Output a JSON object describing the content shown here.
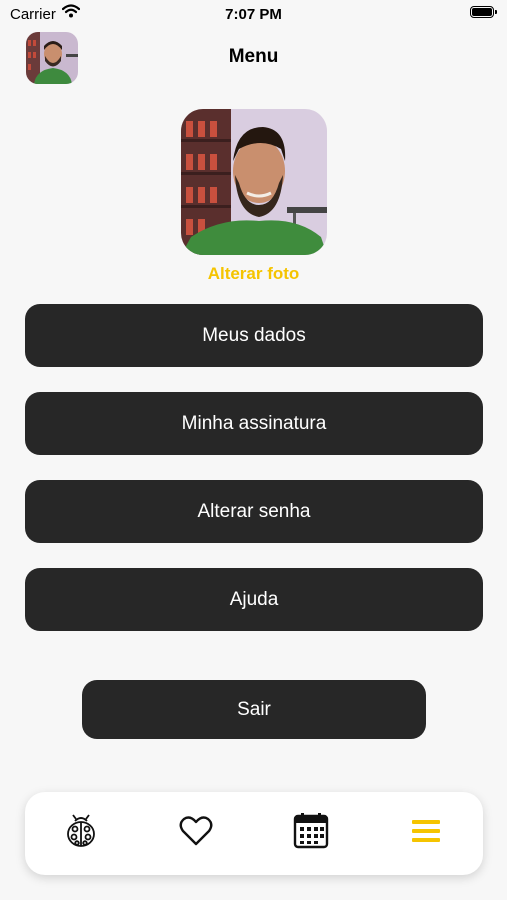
{
  "status_bar": {
    "carrier": "Carrier",
    "time": "7:07 PM"
  },
  "header": {
    "title": "Menu"
  },
  "profile": {
    "change_photo_label": "Alterar foto"
  },
  "menu": {
    "items": [
      {
        "label": "Meus dados"
      },
      {
        "label": "Minha assinatura"
      },
      {
        "label": "Alterar senha"
      },
      {
        "label": "Ajuda"
      }
    ],
    "logout_label": "Sair"
  },
  "tabbar": {
    "tabs": [
      {
        "icon": "ladybug-icon"
      },
      {
        "icon": "heart-icon"
      },
      {
        "icon": "calendar-icon"
      },
      {
        "icon": "menu-icon",
        "active": true
      }
    ]
  },
  "colors": {
    "accent": "#f5c400",
    "button_bg": "#272727",
    "background": "#f7f7f7"
  }
}
